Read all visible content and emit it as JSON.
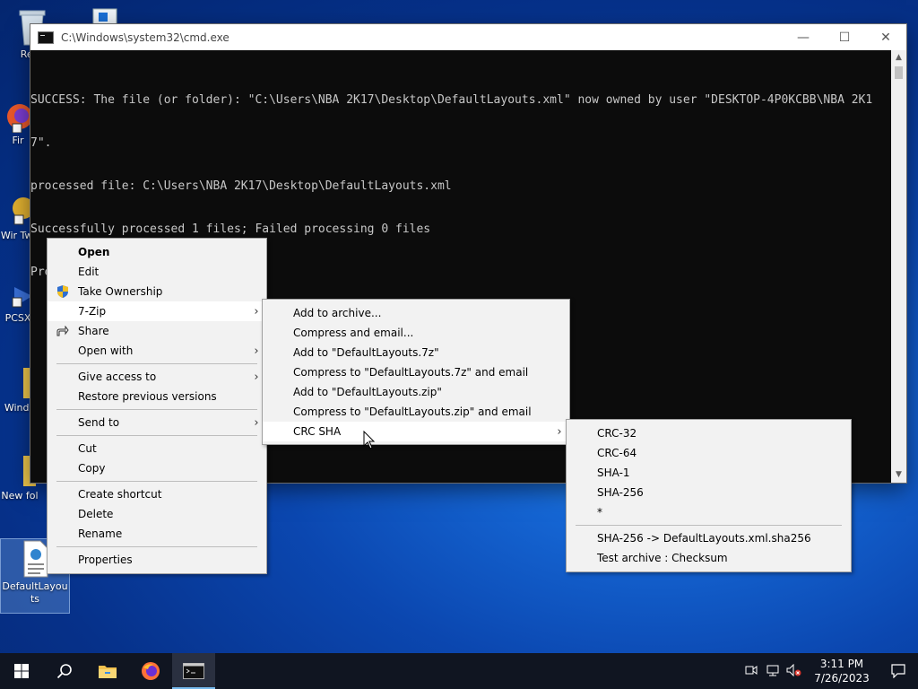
{
  "desktop": {
    "icons": [
      {
        "label": "Recy",
        "name": "recycle-bin-icon"
      },
      {
        "label": "Fir",
        "name": "firefox-shortcut-icon"
      },
      {
        "label": "Wir Twe",
        "name": "winaero-tweaker-shortcut-icon"
      },
      {
        "label": "PCSX",
        "name": "pcsx-shortcut-icon"
      },
      {
        "label": "Windo",
        "name": "windows-folder-icon"
      },
      {
        "label": "New fol",
        "name": "new-folder-icon"
      },
      {
        "label": "DefaultLayouts",
        "name": "defaultlayouts-file-icon"
      }
    ]
  },
  "cmd": {
    "title": "C:\\Windows\\system32\\cmd.exe",
    "minimize": "—",
    "maximize": "☐",
    "close": "✕",
    "lines": [
      "SUCCESS: The file (or folder): \"C:\\Users\\NBA 2K17\\Desktop\\DefaultLayouts.xml\" now owned by user \"DESKTOP-4P0KCBB\\NBA 2K1",
      "7\".",
      "processed file: C:\\Users\\NBA 2K17\\Desktop\\DefaultLayouts.xml",
      "Successfully processed 1 files; Failed processing 0 files",
      "Press any key to continue . . ."
    ]
  },
  "context_menu": {
    "items": [
      {
        "label": "Open"
      },
      {
        "label": "Edit"
      },
      {
        "label": "Take Ownership"
      },
      {
        "label": "7-Zip"
      },
      {
        "label": "Share"
      },
      {
        "label": "Open with"
      },
      {
        "label": "Give access to"
      },
      {
        "label": "Restore previous versions"
      },
      {
        "label": "Send to"
      },
      {
        "label": "Cut"
      },
      {
        "label": "Copy"
      },
      {
        "label": "Create shortcut"
      },
      {
        "label": "Delete"
      },
      {
        "label": "Rename"
      },
      {
        "label": "Properties"
      }
    ]
  },
  "zip_menu": {
    "items": [
      {
        "label": "Add to archive..."
      },
      {
        "label": "Compress and email..."
      },
      {
        "label": "Add to \"DefaultLayouts.7z\""
      },
      {
        "label": "Compress to \"DefaultLayouts.7z\" and email"
      },
      {
        "label": "Add to \"DefaultLayouts.zip\""
      },
      {
        "label": "Compress to \"DefaultLayouts.zip\" and email"
      },
      {
        "label": "CRC SHA"
      }
    ]
  },
  "crc_menu": {
    "items": [
      {
        "label": "CRC-32"
      },
      {
        "label": "CRC-64"
      },
      {
        "label": "SHA-1"
      },
      {
        "label": "SHA-256"
      },
      {
        "label": "*"
      },
      {
        "label": "SHA-256 -> DefaultLayouts.xml.sha256"
      },
      {
        "label": "Test archive : Checksum"
      }
    ]
  },
  "taskbar": {
    "time": "3:11 PM",
    "date": "7/26/2023"
  },
  "colors": {
    "desktop_blue": "#0b47b0",
    "taskbar": "#101521",
    "menu_bg": "#f2f2f2",
    "menu_highlight": "#ffffff",
    "console_text": "#c8c8c8"
  }
}
